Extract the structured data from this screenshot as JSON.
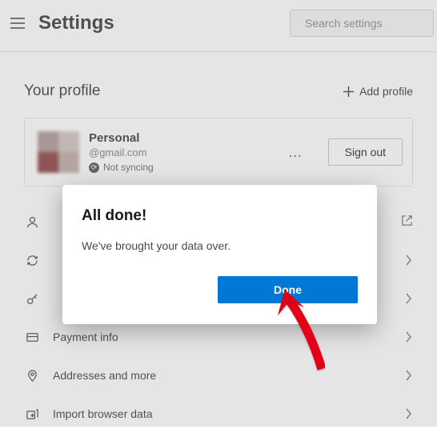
{
  "header": {
    "title": "Settings",
    "search_placeholder": "Search settings"
  },
  "profile": {
    "section_title": "Your profile",
    "add_profile_label": "Add profile",
    "name": "Personal",
    "email_suffix": "@gmail.com",
    "sync_status": "Not syncing",
    "more_label": "…",
    "signout_label": "Sign out"
  },
  "list": {
    "items": [
      {
        "id": "manage-account",
        "label": ""
      },
      {
        "id": "sync",
        "label": ""
      },
      {
        "id": "passwords",
        "label": ""
      },
      {
        "id": "payment",
        "label": "Payment info"
      },
      {
        "id": "addresses",
        "label": "Addresses and more"
      },
      {
        "id": "import",
        "label": "Import browser data"
      }
    ]
  },
  "modal": {
    "title": "All done!",
    "body": "We've brought your data over.",
    "done_label": "Done"
  }
}
